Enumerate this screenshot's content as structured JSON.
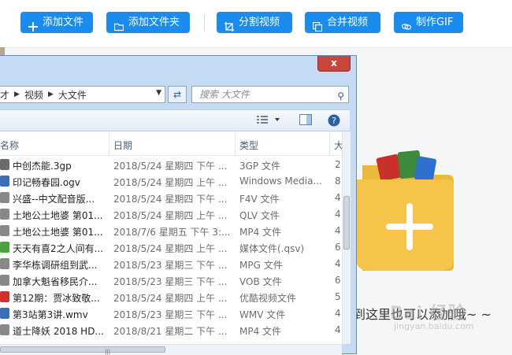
{
  "toolbar": {
    "buttons": [
      {
        "label": "添加文件",
        "icon": "plus-icon"
      },
      {
        "label": "添加文件夹",
        "icon": "folder-icon"
      },
      {
        "label": "分割视频",
        "icon": "crop-icon"
      },
      {
        "label": "合并视频",
        "icon": "copy-icon"
      },
      {
        "label": "制作GIF",
        "icon": "link-icon"
      }
    ]
  },
  "main": {
    "drop_hint": "到这里也可以添加哦~ ~",
    "watermark": "Bai 经验",
    "watermark_sub": "jingyan.baidu.com"
  },
  "dialog": {
    "close_label": "x",
    "address": [
      "才",
      "视频",
      "大文件"
    ],
    "search_placeholder": "搜索 大文件",
    "columns": {
      "name": "名称",
      "date": "日期",
      "type": "类型",
      "size": "大"
    },
    "files": [
      {
        "name": "中创杰能.3gp",
        "date": "2018/5/24 星期四 下午 ...",
        "type": "3GP 文件",
        "size": "2",
        "icon_color": "#6b6b6b"
      },
      {
        "name": "印记畅春园.ogv",
        "date": "2018/5/24 星期四 上午 ...",
        "type": "Windows Media...",
        "size": "8",
        "icon_color": "#3a6fb5"
      },
      {
        "name": "兴盛--中文配音版...",
        "date": "2018/5/24 星期四 下午 ...",
        "type": "F4V 文件",
        "size": "4",
        "icon_color": "#888888"
      },
      {
        "name": "土地公土地婆 第01...",
        "date": "2018/5/24 星期四 上午 ...",
        "type": "QLV 文件",
        "size": "4",
        "icon_color": "#888888"
      },
      {
        "name": "土地公土地婆 第01...",
        "date": "2018/7/6 星期五 下午 3:...",
        "type": "MP4 文件",
        "size": "4",
        "icon_color": "#888888"
      },
      {
        "name": "天天有喜2之人间有...",
        "date": "2018/5/24 星期四 上午 ...",
        "type": "媒体文件(.qsv)",
        "size": "6",
        "icon_color": "#4aa33a"
      },
      {
        "name": "李华栋调研组到武...",
        "date": "2018/5/23 星期三 下午 ...",
        "type": "MPG 文件",
        "size": "4",
        "icon_color": "#888888"
      },
      {
        "name": "加拿大魁省移民介...",
        "date": "2018/5/23 星期三 下午 ...",
        "type": "VOB 文件",
        "size": "6",
        "icon_color": "#888888"
      },
      {
        "name": "第12期：贾冰致敬...",
        "date": "2018/5/24 星期四 上午 ...",
        "type": "优酷视频文件",
        "size": "5",
        "icon_color": "#d2302a"
      },
      {
        "name": "第3站第3讲.wmv",
        "date": "2018/5/23 星期三 下午 ...",
        "type": "WMV 文件",
        "size": "4",
        "icon_color": "#3a6fb5"
      },
      {
        "name": "道士降妖 2018 HD...",
        "date": "2018/8/21 星期二 下午 ...",
        "type": "MP4 文件",
        "size": "4",
        "icon_color": "#888888"
      }
    ]
  }
}
